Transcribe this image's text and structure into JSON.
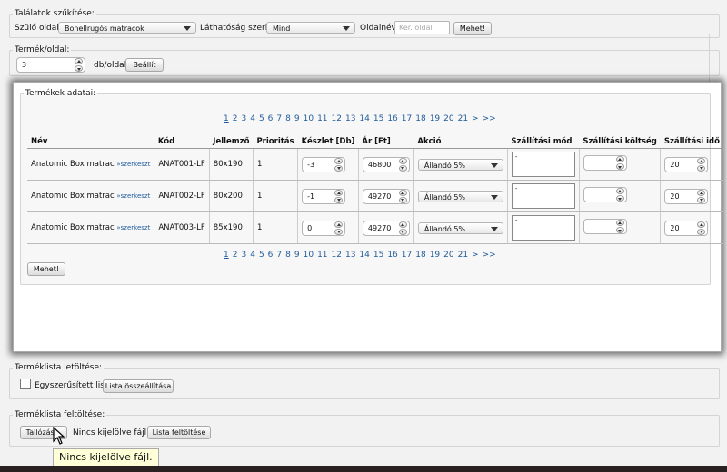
{
  "filter": {
    "legend": "Találatok szűkítése:",
    "parent_label": "Szülő oldal:",
    "parent_value": "Bonellrugós matracok",
    "visibility_label": "Láthatóság szerint:",
    "visibility_value": "Mind",
    "pagename_label": "Oldalnév:",
    "pagename_placeholder": "Ker. oldal",
    "go_label": "Mehet!"
  },
  "perpage": {
    "legend": "Termék/oldal:",
    "value": "3",
    "unit": "db/oldal",
    "set_label": "Beállít"
  },
  "products": {
    "legend": "Termékek adatai:",
    "pages": [
      "1",
      "2",
      "3",
      "4",
      "5",
      "6",
      "7",
      "8",
      "9",
      "10",
      "11",
      "12",
      "13",
      "14",
      "15",
      "16",
      "17",
      "18",
      "19",
      "20",
      "21",
      ">",
      ">>"
    ],
    "columns": [
      "Név",
      "Kód",
      "Jellemző",
      "Prioritás",
      "Készlet [Db]",
      "Ár [Ft]",
      "Akció",
      "Szállítási mód",
      "Szállítási költség",
      "Szállítási idő"
    ],
    "edit_label": "»szerkeszt",
    "rows": [
      {
        "name": "Anatomic Box matrac",
        "code": "ANAT001-LF",
        "feature": "80x190",
        "priority": "1",
        "stock": "-3",
        "price": "46800",
        "action": "Állandó 5%",
        "ship_mode": "-",
        "ship_cost": "",
        "ship_time": "20"
      },
      {
        "name": "Anatomic Box matrac",
        "code": "ANAT002-LF",
        "feature": "80x200",
        "priority": "1",
        "stock": "-1",
        "price": "49270",
        "action": "Állandó 5%",
        "ship_mode": "-",
        "ship_cost": "",
        "ship_time": "20"
      },
      {
        "name": "Anatomic Box matrac",
        "code": "ANAT003-LF",
        "feature": "85x190",
        "priority": "1",
        "stock": "0",
        "price": "49270",
        "action": "Állandó 5%",
        "ship_mode": "-",
        "ship_cost": "",
        "ship_time": "20"
      }
    ],
    "go_label": "Mehet!"
  },
  "download": {
    "legend": "Terméklista letöltése:",
    "simple_label": "Egyszerűsített lista",
    "build_label": "Lista összeállítása"
  },
  "upload": {
    "legend": "Terméklista feltöltése:",
    "browse_label": "Tallózás...",
    "no_file": "Nincs kijelölve fájl.",
    "upload_label": "Lista feltöltése"
  },
  "tooltip": "Nincs kijelölve fájl."
}
